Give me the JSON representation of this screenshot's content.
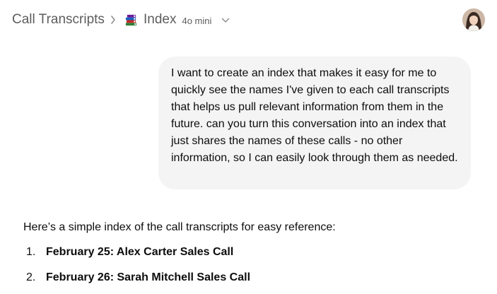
{
  "header": {
    "breadcrumb_root": "Call Transcripts",
    "separator_icon": "chevron-right-icon",
    "project_emoji_icon": "books-icon",
    "chat_title": "Index",
    "model": "4o mini",
    "model_menu_icon": "chevron-down-icon",
    "avatar_icon": "user-avatar"
  },
  "conversation": {
    "user_message": "I want to create an index that makes it easy for me to quickly see the names I've given to each call transcripts that helps us pull relevant information from them in the future. can you turn this conversation into an index that just shares the names of these calls - no other information, so I can easily look through them as needed.",
    "assistant": {
      "intro": "Here’s a simple index of the call transcripts for easy reference:",
      "items": [
        {
          "number": "1.",
          "name": "February 25: Alex Carter Sales Call"
        },
        {
          "number": "2.",
          "name": "February 26: Sarah Mitchell Sales Call"
        }
      ]
    }
  },
  "colors": {
    "user_bubble_bg": "#f4f4f4",
    "text": "#0d0d0d",
    "muted_text": "#5d5d5d"
  }
}
